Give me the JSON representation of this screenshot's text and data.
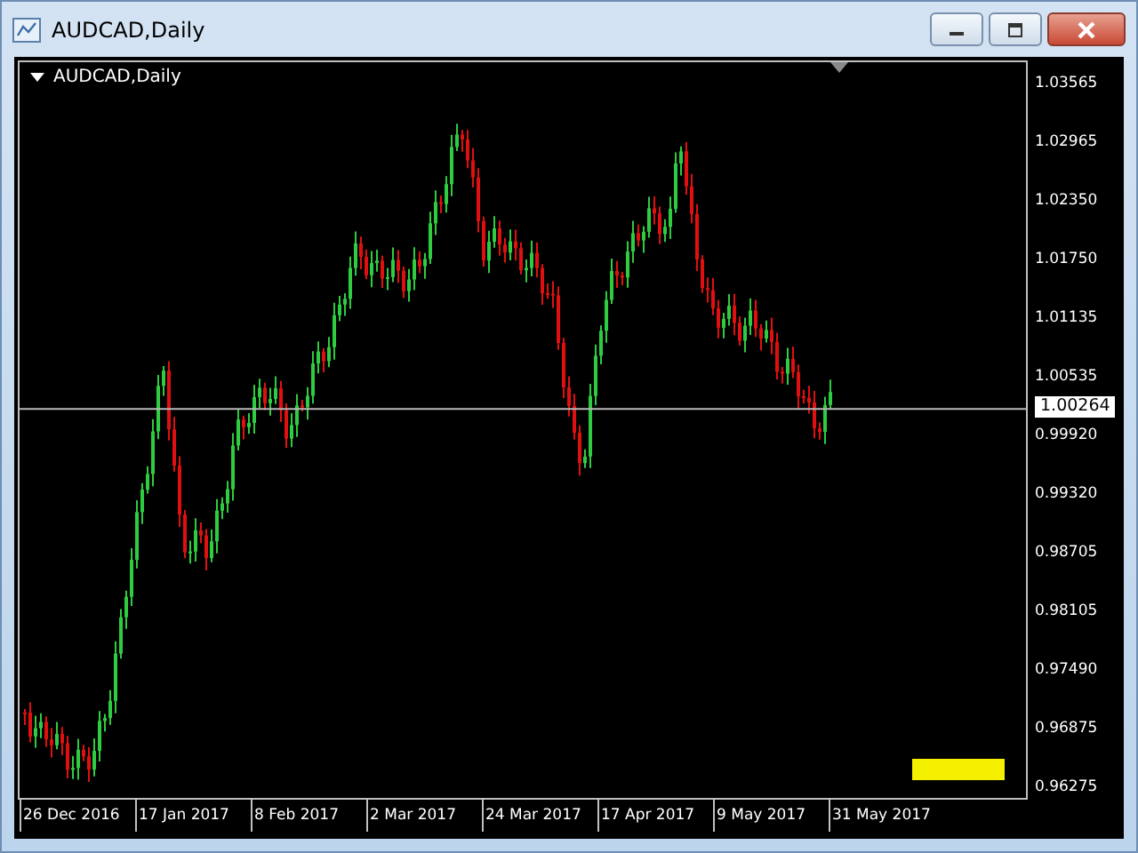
{
  "window": {
    "title": "AUDCAD,Daily"
  },
  "chart": {
    "label": "AUDCAD,Daily",
    "price_axis": [
      "1.03565",
      "1.02965",
      "1.02350",
      "1.01750",
      "1.01135",
      "1.00535",
      "0.99920",
      "0.99320",
      "0.98705",
      "0.98105",
      "0.97490",
      "0.96875",
      "0.96275"
    ],
    "current_price": "1.00264",
    "time_axis": [
      "26 Dec 2016",
      "17 Jan 2017",
      "8 Feb 2017",
      "2 Mar 2017",
      "24 Mar 2017",
      "17 Apr 2017",
      "9 May 2017",
      "31 May 2017"
    ]
  }
}
